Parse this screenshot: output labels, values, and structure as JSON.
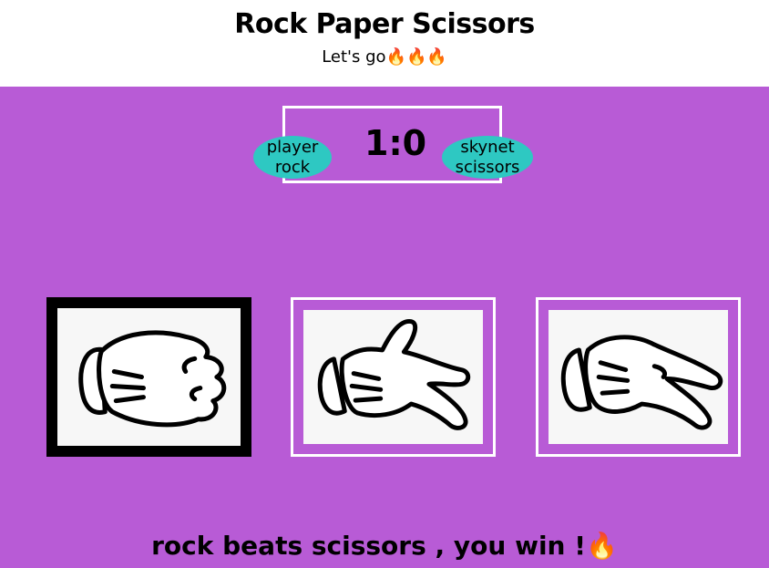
{
  "header": {
    "title": "Rock Paper Scissors",
    "subtitle": "Let's go🔥🔥🔥"
  },
  "scoreboard": {
    "player_name": "player",
    "player_choice": "rock",
    "score": "1:0",
    "opponent_name": "skynet",
    "opponent_choice": "scissors"
  },
  "choices": [
    {
      "id": "rock",
      "icon": "rock-hand-icon",
      "selected": true
    },
    {
      "id": "paper",
      "icon": "paper-hand-icon",
      "selected": false
    },
    {
      "id": "scissors",
      "icon": "scissors-hand-icon",
      "selected": false
    }
  ],
  "result": {
    "message": "rock beats scissors , you win !🔥"
  },
  "colors": {
    "arena_background": "#b85bd6",
    "badge": "#2ec8c2",
    "selected_border": "#000000",
    "card_border": "#ffffff"
  }
}
